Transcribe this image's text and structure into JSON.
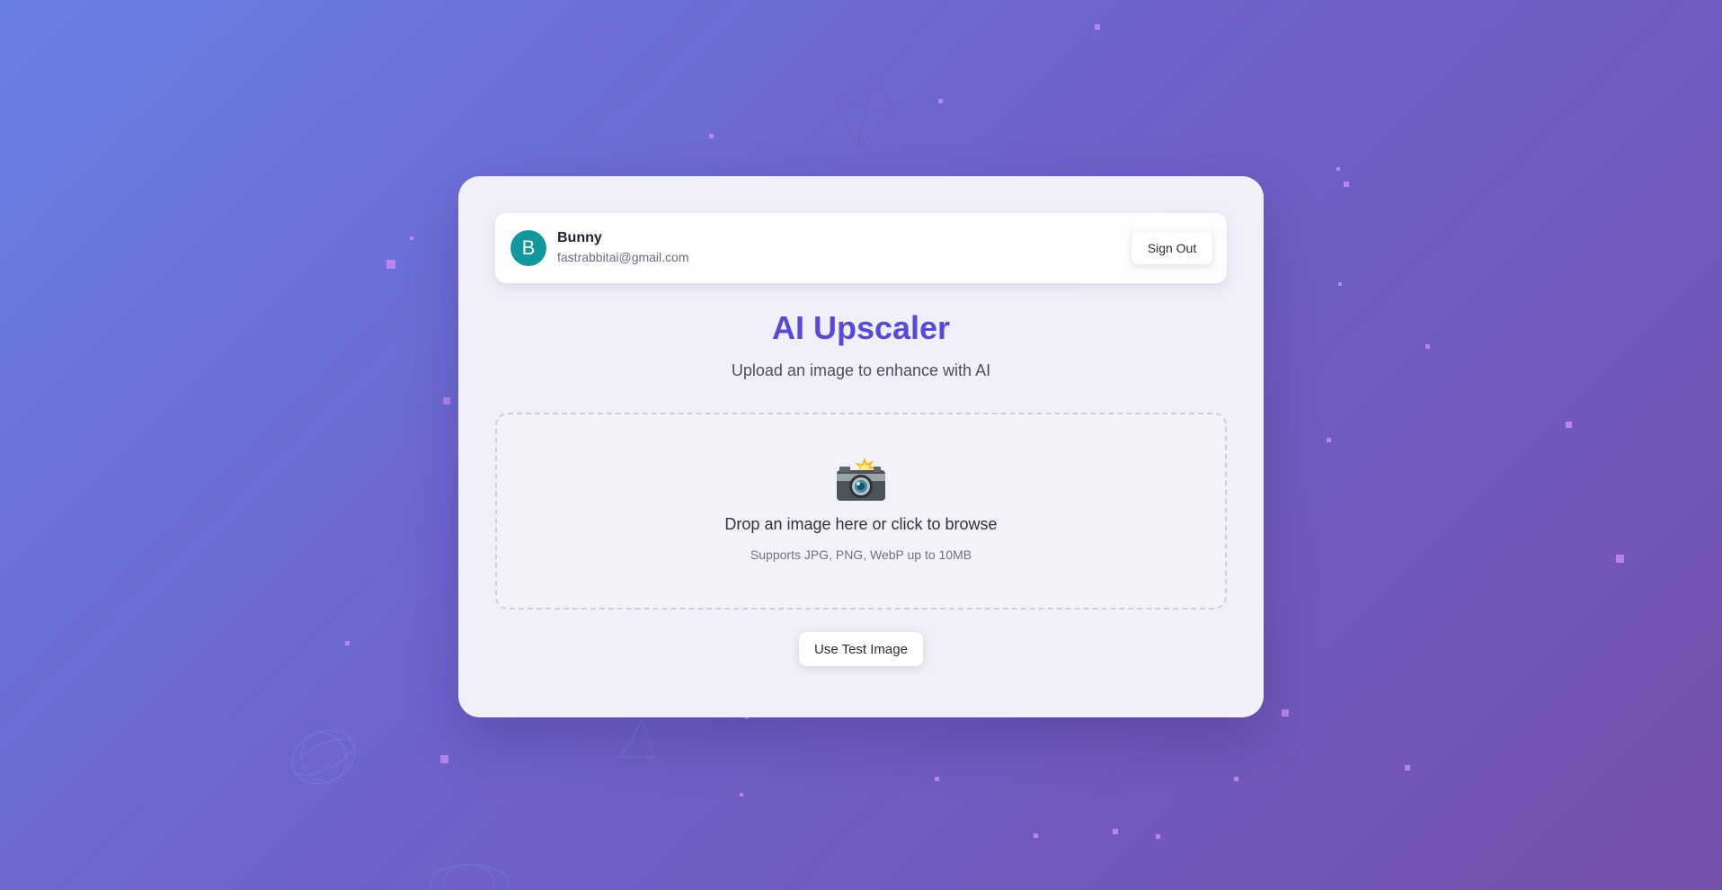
{
  "user": {
    "avatar_initial": "B",
    "name": "Bunny",
    "email": "fastrabbitai@gmail.com",
    "sign_out_label": "Sign Out"
  },
  "main": {
    "title": "AI Upscaler",
    "subtitle": "Upload an image to enhance with AI"
  },
  "dropzone": {
    "icon": "camera-flash-icon",
    "text": "Drop an image here or click to browse",
    "hint": "Supports JPG, PNG, WebP up to 10MB"
  },
  "actions": {
    "test_image_label": "Use Test Image"
  },
  "colors": {
    "accent": "#5a49d6",
    "avatar_bg": "#14979c",
    "background_start": "#6a7fe6",
    "background_end": "#7550ab",
    "particle": "#c48cf4"
  }
}
